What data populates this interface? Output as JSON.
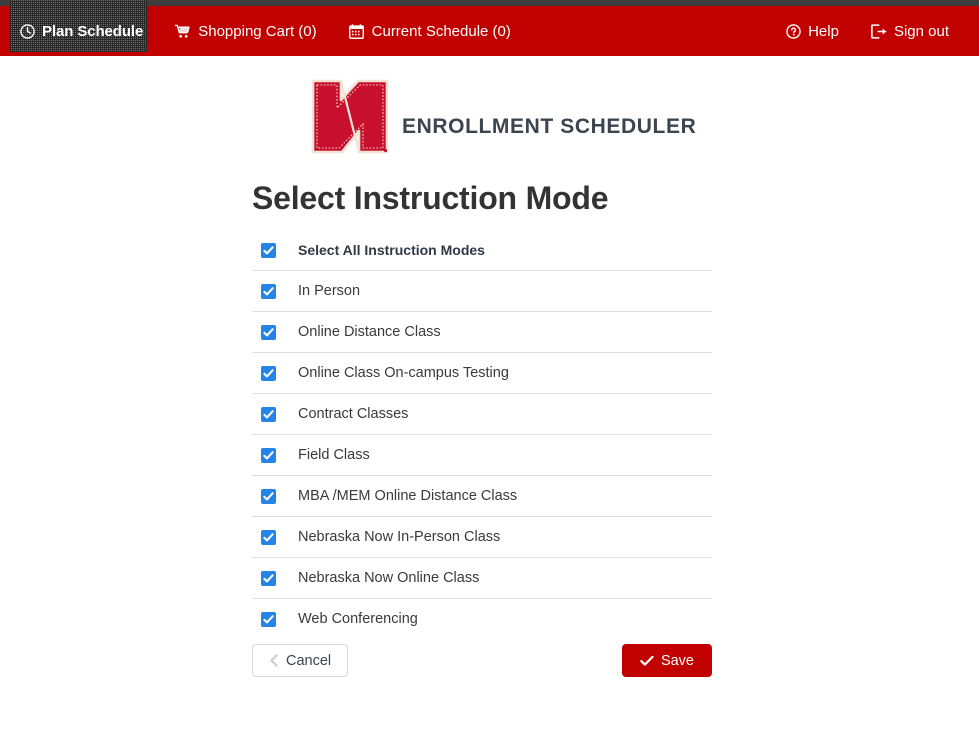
{
  "navbar": {
    "background_color": "#c10000",
    "top_strip_color": "#3d3d3d",
    "left_items": [
      {
        "label": "Plan Schedule",
        "icon": "clock-icon",
        "active": true
      },
      {
        "label": "Shopping Cart (0)",
        "icon": "shopping-cart-icon",
        "active": false
      },
      {
        "label": "Current Schedule (0)",
        "icon": "calendar-icon",
        "active": false
      }
    ],
    "right_items": [
      {
        "label": "Help",
        "icon": "question-circle-icon"
      },
      {
        "label": "Sign out",
        "icon": "sign-out-icon"
      }
    ]
  },
  "brand": {
    "logo_name": "nebraska-n-logo",
    "logo_color": "#c8102e",
    "title": "ENROLLMENT SCHEDULER",
    "title_color": "#3b4550"
  },
  "page": {
    "title": "Select Instruction Mode"
  },
  "instruction_modes": {
    "checkbox_color": "#2684e8",
    "select_all": {
      "label": "Select All Instruction Modes",
      "checked": true
    },
    "items": [
      {
        "label": "In Person",
        "checked": true
      },
      {
        "label": "Online Distance Class",
        "checked": true
      },
      {
        "label": "Online Class On-campus Testing",
        "checked": true
      },
      {
        "label": "Contract Classes",
        "checked": true
      },
      {
        "label": "Field Class",
        "checked": true
      },
      {
        "label": "MBA /MEM Online Distance Class",
        "checked": true
      },
      {
        "label": "Nebraska Now In-Person Class",
        "checked": true
      },
      {
        "label": "Nebraska Now Online Class",
        "checked": true
      },
      {
        "label": "Web Conferencing",
        "checked": true
      }
    ]
  },
  "actions": {
    "cancel_label": "Cancel",
    "save_label": "Save",
    "save_color": "#c10000"
  }
}
